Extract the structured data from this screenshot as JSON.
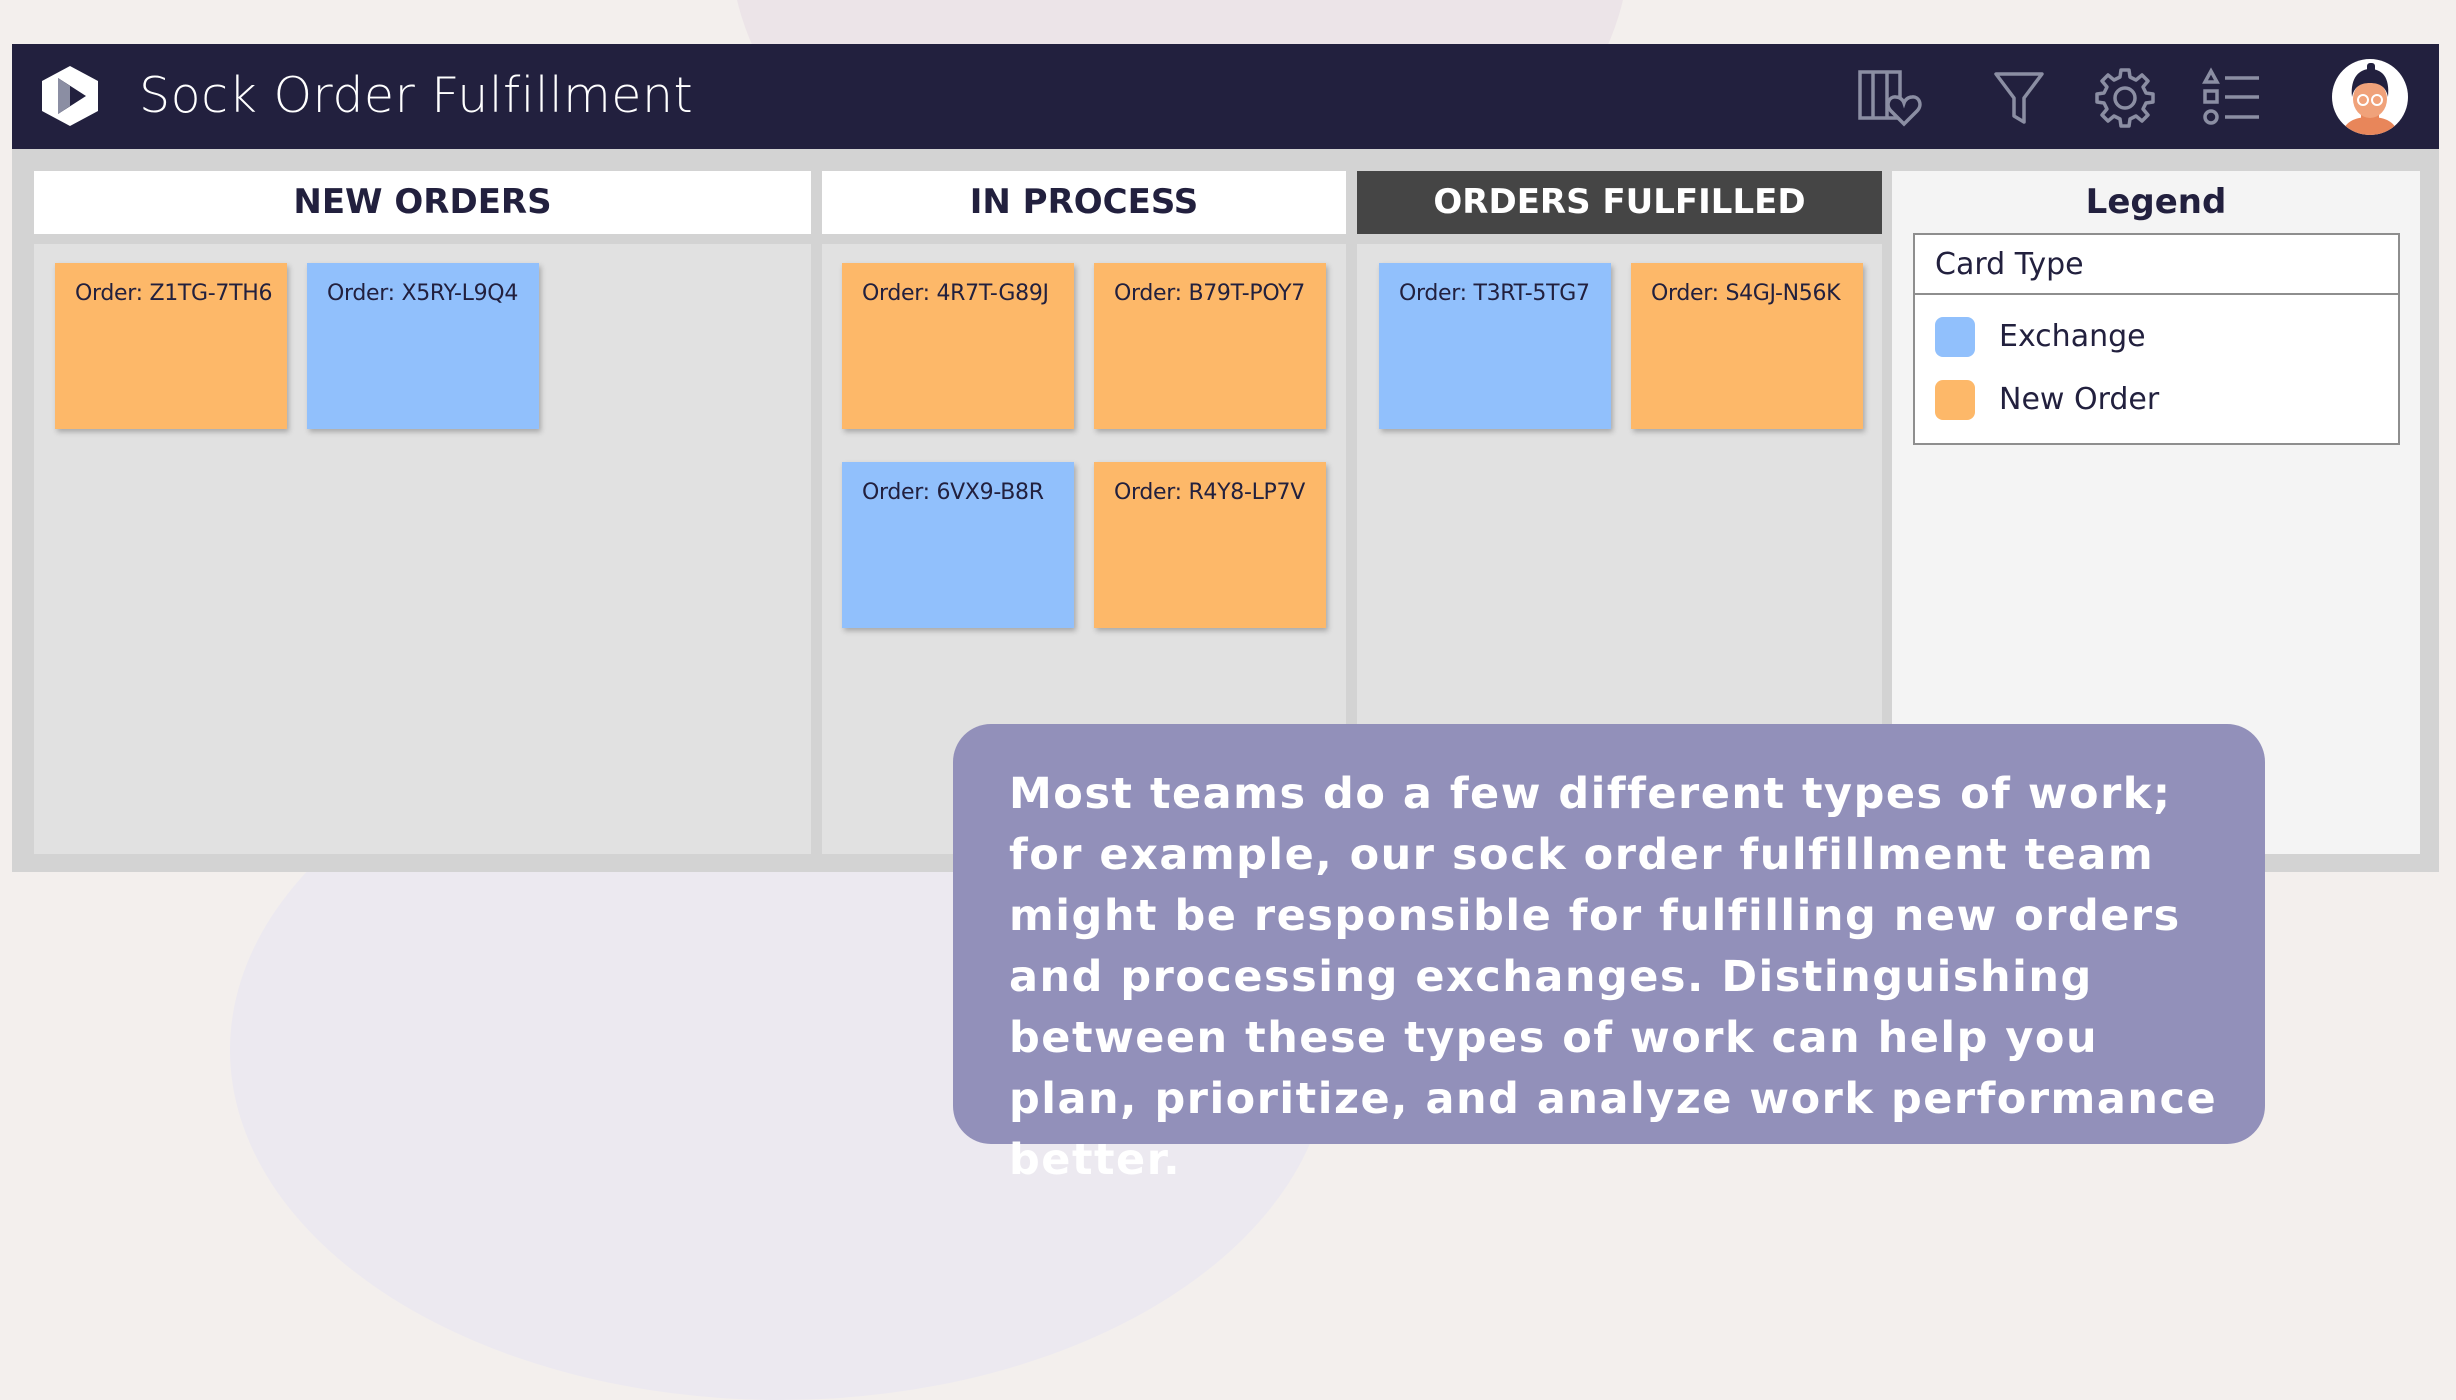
{
  "header": {
    "title": "Sock Order Fulfillment",
    "logo_icon": "play-logo-icon",
    "icons": [
      "board-heart-icon",
      "filter-icon",
      "gear-icon",
      "list-icon"
    ],
    "avatar": "user-avatar"
  },
  "columns": [
    {
      "title": "NEW ORDERS",
      "cards": [
        {
          "label": "Order: Z1TG-7TH6",
          "type": "New Order"
        },
        {
          "label": "Order: X5RY-L9Q4",
          "type": "Exchange"
        }
      ]
    },
    {
      "title": "IN PROCESS",
      "cards": [
        {
          "label": "Order: 4R7T-G89J",
          "type": "New Order"
        },
        {
          "label": "Order: B79T-POY7",
          "type": "New Order"
        },
        {
          "label": "Order: 6VX9-B8R",
          "type": "Exchange"
        },
        {
          "label": "Order: R4Y8-LP7V",
          "type": "New Order"
        }
      ]
    },
    {
      "title": "ORDERS FULFILLED",
      "cards": [
        {
          "label": "Order: T3RT-5TG7",
          "type": "Exchange"
        },
        {
          "label": "Order: S4GJ-N56K",
          "type": "New Order"
        }
      ]
    }
  ],
  "legend": {
    "title": "Legend",
    "header": "Card Type",
    "items": [
      {
        "label": "Exchange",
        "color": "#91c0fc"
      },
      {
        "label": "New Order",
        "color": "#fdb869"
      }
    ]
  },
  "callout": {
    "text": "Most teams do a few different types of work; for example, our sock order fulfillment team might be responsible for fulfilling new orders and processing exchanges. Distinguishing between these types of work can help you plan, prioritize, and analyze work performance better."
  },
  "colors": {
    "topbar": "#22203e",
    "new_order": "#fdb869",
    "exchange": "#91c0fc",
    "callout": "#9290ba"
  }
}
